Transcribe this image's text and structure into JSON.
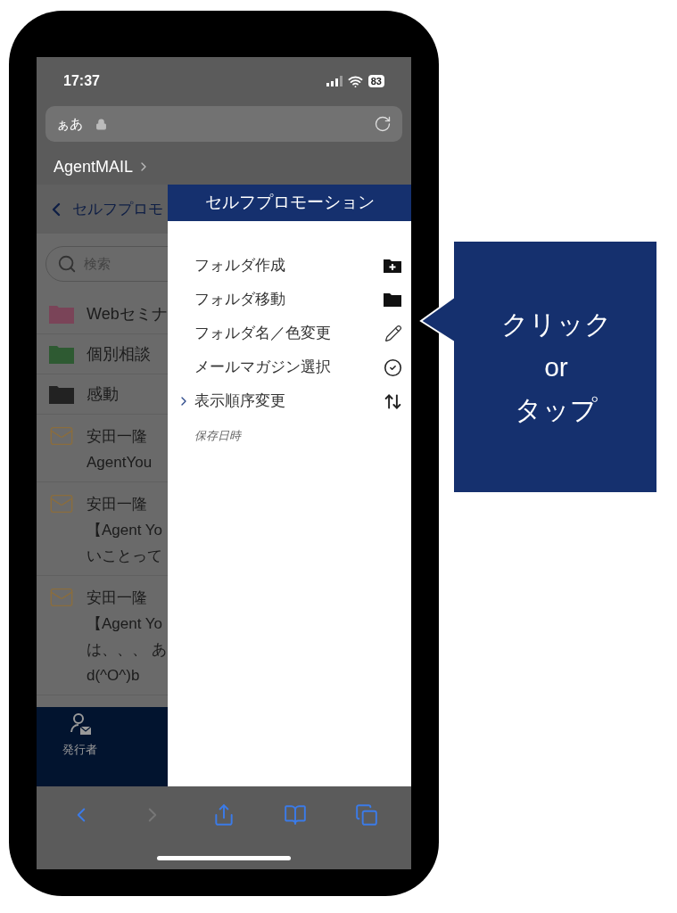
{
  "status_bar": {
    "time": "17:37",
    "battery": "83"
  },
  "url_bar": {
    "text": "ぁあ"
  },
  "breadcrumb": "AgentMAIL",
  "back_header": "セルフプロモ",
  "search": {
    "placeholder": "検索"
  },
  "folders": [
    {
      "name": "Webセミナ",
      "color": "#7a4458"
    },
    {
      "name": "個別相談",
      "color": "#2e5a32"
    },
    {
      "name": "感動",
      "color": "#222222"
    }
  ],
  "mails": [
    {
      "sender": "安田一隆",
      "lines": [
        "AgentYou"
      ]
    },
    {
      "sender": "安田一隆",
      "lines": [
        "【Agent Yo",
        "いことって"
      ]
    },
    {
      "sender": "安田一隆",
      "lines": [
        "【Agent Yo",
        "は、、、 あ",
        "d(^O^)b"
      ]
    }
  ],
  "tab_bar": {
    "label": "発行者"
  },
  "drawer": {
    "title": "セルフプロモーション",
    "items": [
      {
        "label": "フォルダ作成",
        "kind": "folder-plus",
        "selected": false
      },
      {
        "label": "フォルダ移動",
        "kind": "folder",
        "selected": false
      },
      {
        "label": "フォルダ名／色変更",
        "kind": "pencil",
        "selected": false
      },
      {
        "label": "メールマガジン選択",
        "kind": "check-circle",
        "selected": false
      },
      {
        "label": "表示順序変更",
        "kind": "sort",
        "selected": true
      }
    ],
    "sub_label": "保存日時"
  },
  "toolbar": [
    {
      "kind": "back",
      "disabled": false
    },
    {
      "kind": "forward",
      "disabled": true
    },
    {
      "kind": "share",
      "disabled": false
    },
    {
      "kind": "bookmarks",
      "disabled": false
    },
    {
      "kind": "tabs",
      "disabled": false
    }
  ],
  "callout": {
    "lines": [
      "クリック",
      "or",
      "タップ"
    ]
  }
}
